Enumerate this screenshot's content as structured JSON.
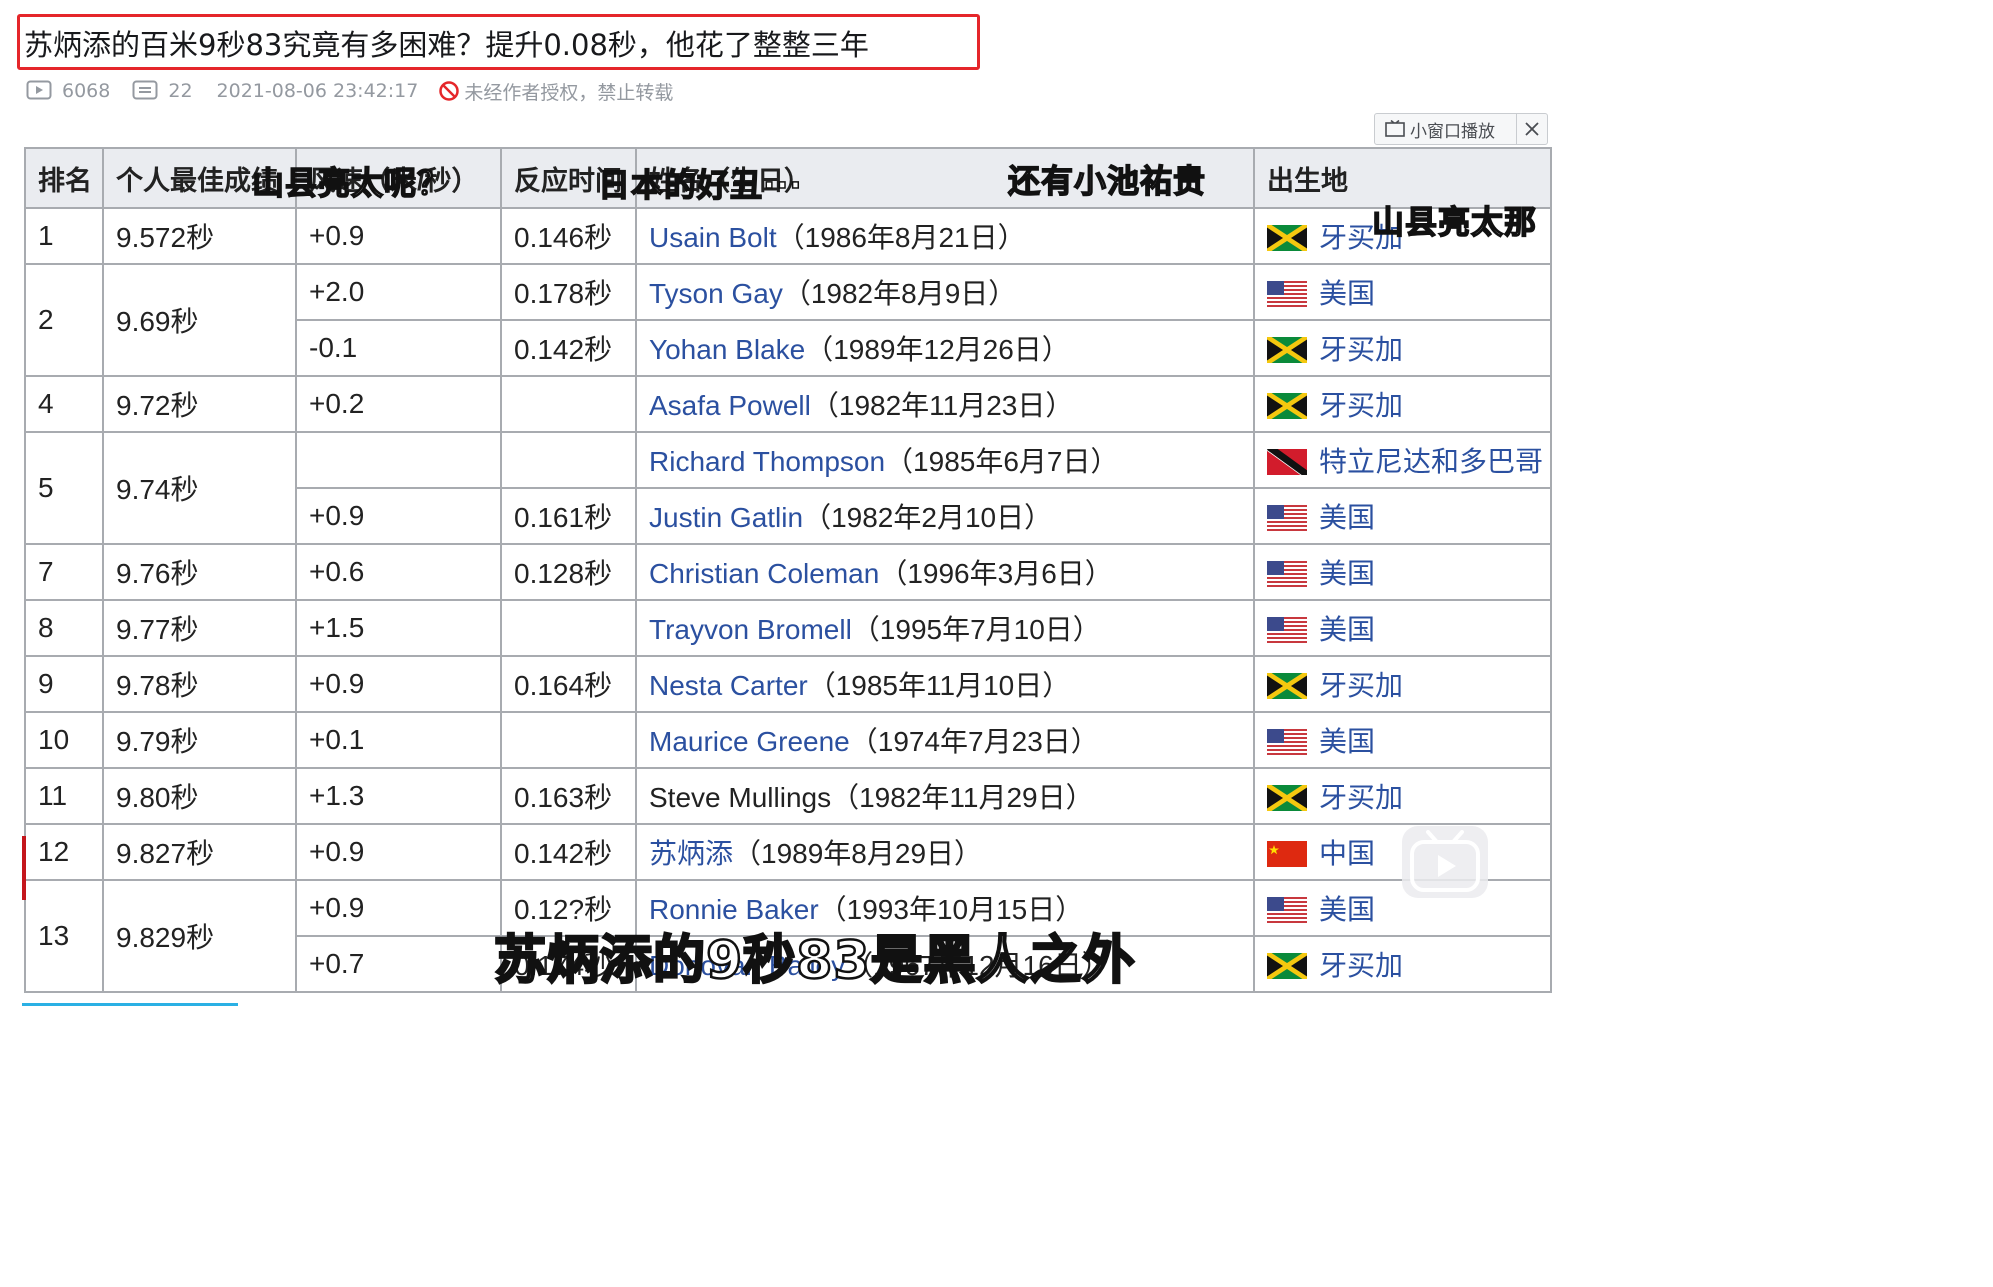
{
  "article": {
    "title": "苏炳添的百米9秒83究竟有多困难？提升0.08秒，他花了整整三年",
    "views": "6068",
    "comments": "22",
    "datetime": "2021-08-06 23:42:17",
    "copyright": "未经作者授权，禁止转载"
  },
  "player": {
    "mini_window_label": "小窗口播放",
    "subtitle": "苏炳添的9秒83是黑人之外",
    "danmaku": [
      "山县亮太呢？",
      "日本的好丑···",
      "还有小池祐贵",
      "山县亮太那"
    ]
  },
  "table": {
    "headers": [
      "排名",
      "个人最佳成绩",
      "风速（米/秒）",
      "反应时间",
      "姓名（生日）",
      "出生地"
    ],
    "rows": [
      {
        "rank": "1",
        "time": "9.572秒",
        "wind": "+0.9",
        "reaction": "0.146秒",
        "name": "Usain Bolt",
        "birth": "（1986年8月21日）",
        "country": "牙买加",
        "flag": "jamaica",
        "link": true
      },
      {
        "rank": "2",
        "time": "9.69秒",
        "wind": "+2.0",
        "reaction": "0.178秒",
        "name": "Tyson Gay",
        "birth": "（1982年8月9日）",
        "country": "美国",
        "flag": "usa",
        "link": true
      },
      {
        "rank": "",
        "time": "",
        "wind": "-0.1",
        "reaction": "0.142秒",
        "name": "Yohan Blake",
        "birth": "（1989年12月26日）",
        "country": "牙买加",
        "flag": "jamaica",
        "link": true
      },
      {
        "rank": "4",
        "time": "9.72秒",
        "wind": "+0.2",
        "reaction": "",
        "name": "Asafa Powell",
        "birth": "（1982年11月23日）",
        "country": "牙买加",
        "flag": "jamaica",
        "link": true
      },
      {
        "rank": "5",
        "time": "9.74秒",
        "wind": "",
        "reaction": "",
        "name": "Richard Thompson",
        "birth": "（1985年6月7日）",
        "country": "特立尼达和多巴哥",
        "flag": "trinidad",
        "link": true
      },
      {
        "rank": "",
        "time": "",
        "wind": "+0.9",
        "reaction": "0.161秒",
        "name": "Justin Gatlin",
        "birth": "（1982年2月10日）",
        "country": "美国",
        "flag": "usa",
        "link": true
      },
      {
        "rank": "7",
        "time": "9.76秒",
        "wind": "+0.6",
        "reaction": "0.128秒",
        "name": "Christian Coleman",
        "birth": "（1996年3月6日）",
        "country": "美国",
        "flag": "usa",
        "link": true
      },
      {
        "rank": "8",
        "time": "9.77秒",
        "wind": "+1.5",
        "reaction": "",
        "name": "Trayvon Bromell",
        "birth": "（1995年7月10日）",
        "country": "美国",
        "flag": "usa",
        "link": true
      },
      {
        "rank": "9",
        "time": "9.78秒",
        "wind": "+0.9",
        "reaction": "0.164秒",
        "name": "Nesta Carter",
        "birth": "（1985年11月10日）",
        "country": "牙买加",
        "flag": "jamaica",
        "link": true
      },
      {
        "rank": "10",
        "time": "9.79秒",
        "wind": "+0.1",
        "reaction": "",
        "name": "Maurice Greene",
        "birth": "（1974年7月23日）",
        "country": "美国",
        "flag": "usa",
        "link": true
      },
      {
        "rank": "11",
        "time": "9.80秒",
        "wind": "+1.3",
        "reaction": "0.163秒",
        "name": "Steve Mullings",
        "birth": "（1982年11月29日）",
        "country": "牙买加",
        "flag": "jamaica",
        "link": false
      },
      {
        "rank": "12",
        "time": "9.827秒",
        "wind": "+0.9",
        "reaction": "0.142秒",
        "name": "苏炳添",
        "birth": "（1989年8月29日）",
        "country": "中国",
        "flag": "china",
        "link": true,
        "highlight": true
      },
      {
        "rank": "13",
        "time": "9.829秒",
        "wind": "+0.9",
        "reaction": "0.12?秒",
        "name": "Ronnie Baker",
        "birth": "（1993年10月15日）",
        "country": "美国",
        "flag": "usa",
        "link": true
      },
      {
        "rank": "",
        "time": "",
        "wind": "+0.7",
        "reaction": "0.174秒",
        "name": "Donovan Bailey",
        "birth": "（1967年12月16日）",
        "country": "牙买加",
        "flag": "jamaica",
        "link": true
      }
    ]
  },
  "colors": {
    "title_border": "#e5262a",
    "highlight_border": "#c4161c",
    "link": "#2b50a0",
    "header_bg": "#eaecf0",
    "progress": "#2ab0e4"
  },
  "icons": [
    "play-count-icon",
    "comment-icon",
    "no-repost-icon",
    "mini-window-icon",
    "close-icon",
    "bilibili-play-icon"
  ]
}
